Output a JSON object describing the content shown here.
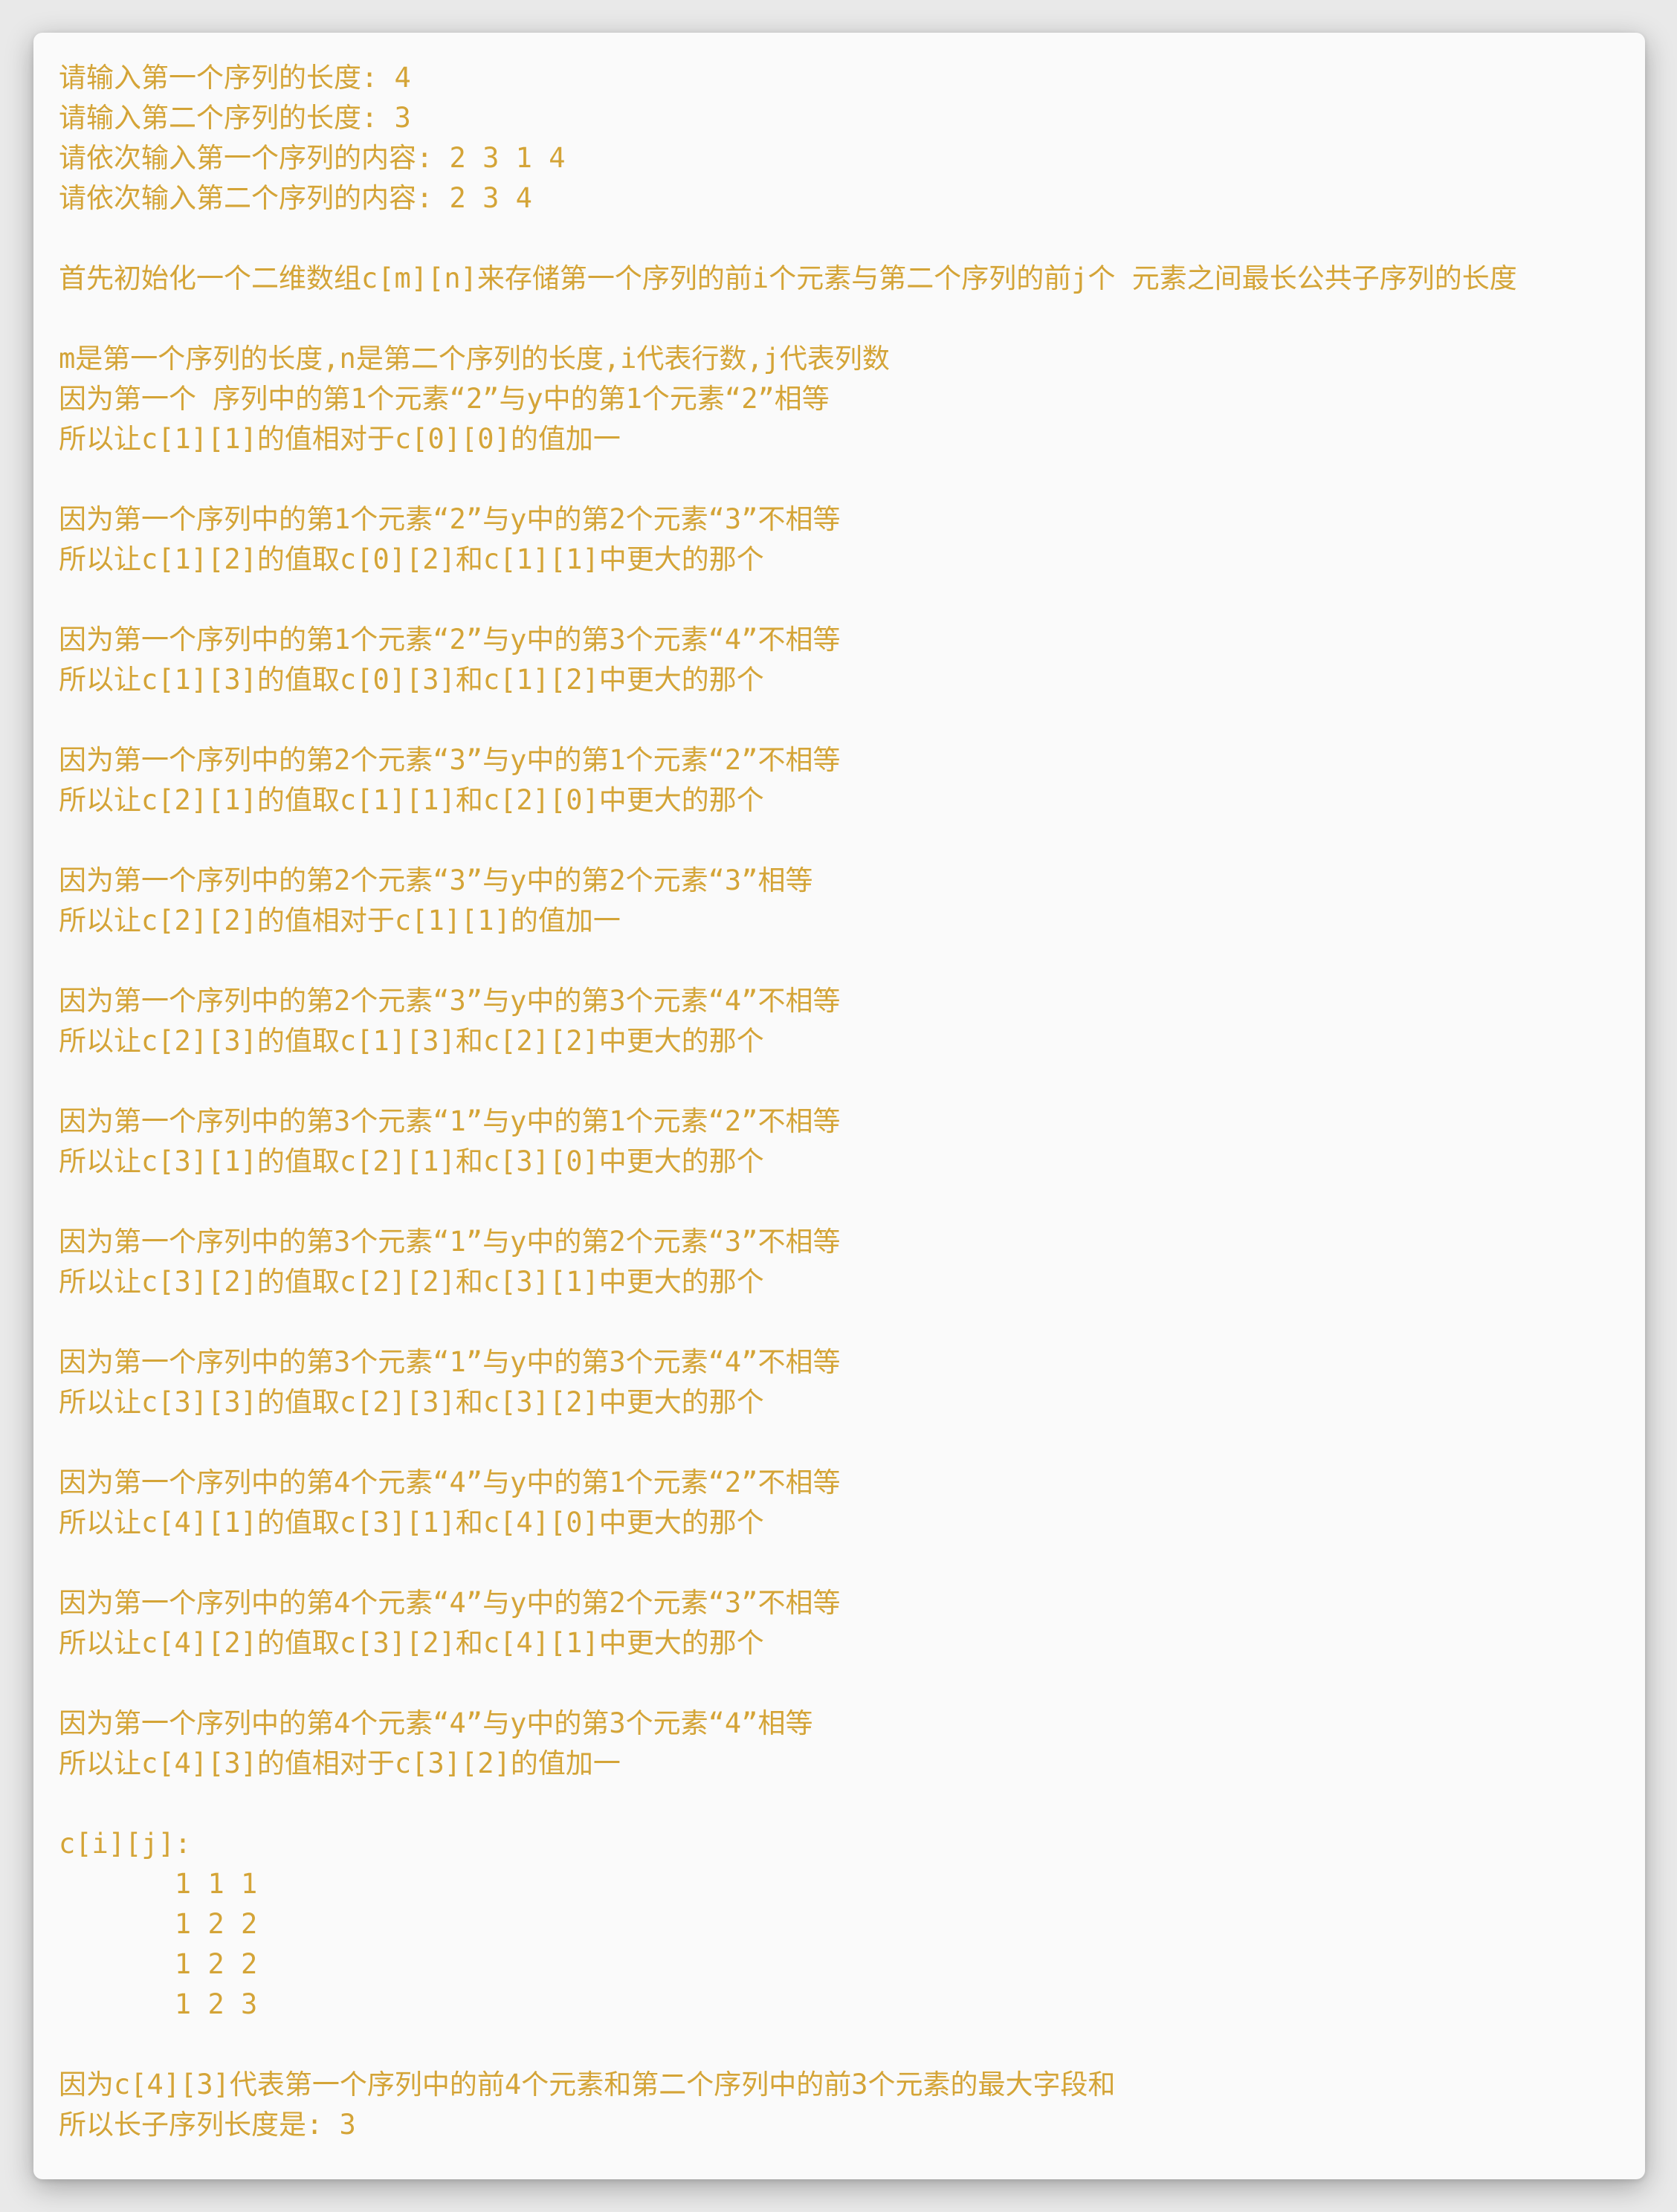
{
  "console_output": {
    "inputs": [
      "请输入第一个序列的长度: 4",
      "请输入第二个序列的长度: 3",
      "请依次输入第一个序列的内容: 2 3 1 4",
      "请依次输入第二个序列的内容: 2 3 4"
    ],
    "intro": "首先初始化一个二维数组c[m][n]来存储第一个序列的前i个元素与第二个序列的前j个 元素之间最长公共子序列的长度",
    "legend": "m是第一个序列的长度,n是第二个序列的长度,i代表行数,j代表列数",
    "steps": [
      {
        "because": "因为第一个 序列中的第1个元素“2”与y中的第1个元素“2”相等",
        "so": "所以让c[1][1]的值相对于c[0][0]的值加一"
      },
      {
        "because": "因为第一个序列中的第1个元素“2”与y中的第2个元素“3”不相等",
        "so": "所以让c[1][2]的值取c[0][2]和c[1][1]中更大的那个"
      },
      {
        "because": "因为第一个序列中的第1个元素“2”与y中的第3个元素“4”不相等",
        "so": "所以让c[1][3]的值取c[0][3]和c[1][2]中更大的那个"
      },
      {
        "because": "因为第一个序列中的第2个元素“3”与y中的第1个元素“2”不相等",
        "so": "所以让c[2][1]的值取c[1][1]和c[2][0]中更大的那个"
      },
      {
        "because": "因为第一个序列中的第2个元素“3”与y中的第2个元素“3”相等",
        "so": "所以让c[2][2]的值相对于c[1][1]的值加一"
      },
      {
        "because": "因为第一个序列中的第2个元素“3”与y中的第3个元素“4”不相等",
        "so": "所以让c[2][3]的值取c[1][3]和c[2][2]中更大的那个"
      },
      {
        "because": "因为第一个序列中的第3个元素“1”与y中的第1个元素“2”不相等",
        "so": "所以让c[3][1]的值取c[2][1]和c[3][0]中更大的那个"
      },
      {
        "because": "因为第一个序列中的第3个元素“1”与y中的第2个元素“3”不相等",
        "so": "所以让c[3][2]的值取c[2][2]和c[3][1]中更大的那个"
      },
      {
        "because": "因为第一个序列中的第3个元素“1”与y中的第3个元素“4”不相等",
        "so": "所以让c[3][3]的值取c[2][3]和c[3][2]中更大的那个"
      },
      {
        "because": "因为第一个序列中的第4个元素“4”与y中的第1个元素“2”不相等",
        "so": "所以让c[4][1]的值取c[3][1]和c[4][0]中更大的那个"
      },
      {
        "because": "因为第一个序列中的第4个元素“4”与y中的第2个元素“3”不相等",
        "so": "所以让c[4][2]的值取c[3][2]和c[4][1]中更大的那个"
      },
      {
        "because": "因为第一个序列中的第4个元素“4”与y中的第3个元素“4”相等",
        "so": "所以让c[4][3]的值相对于c[3][2]的值加一"
      }
    ],
    "matrix_label": "c[i][j]:",
    "matrix_rows": [
      "       1 1 1",
      "       1 2 2",
      "       1 2 2",
      "       1 2 3"
    ],
    "conclusion": "因为c[4][3]代表第一个序列中的前4个元素和第二个序列中的前3个元素的最大字段和",
    "result": "所以长子序列长度是: 3"
  },
  "colors": {
    "text": "#d4a437",
    "panel": "#fafafa",
    "backdrop": "#e9e9e9"
  }
}
